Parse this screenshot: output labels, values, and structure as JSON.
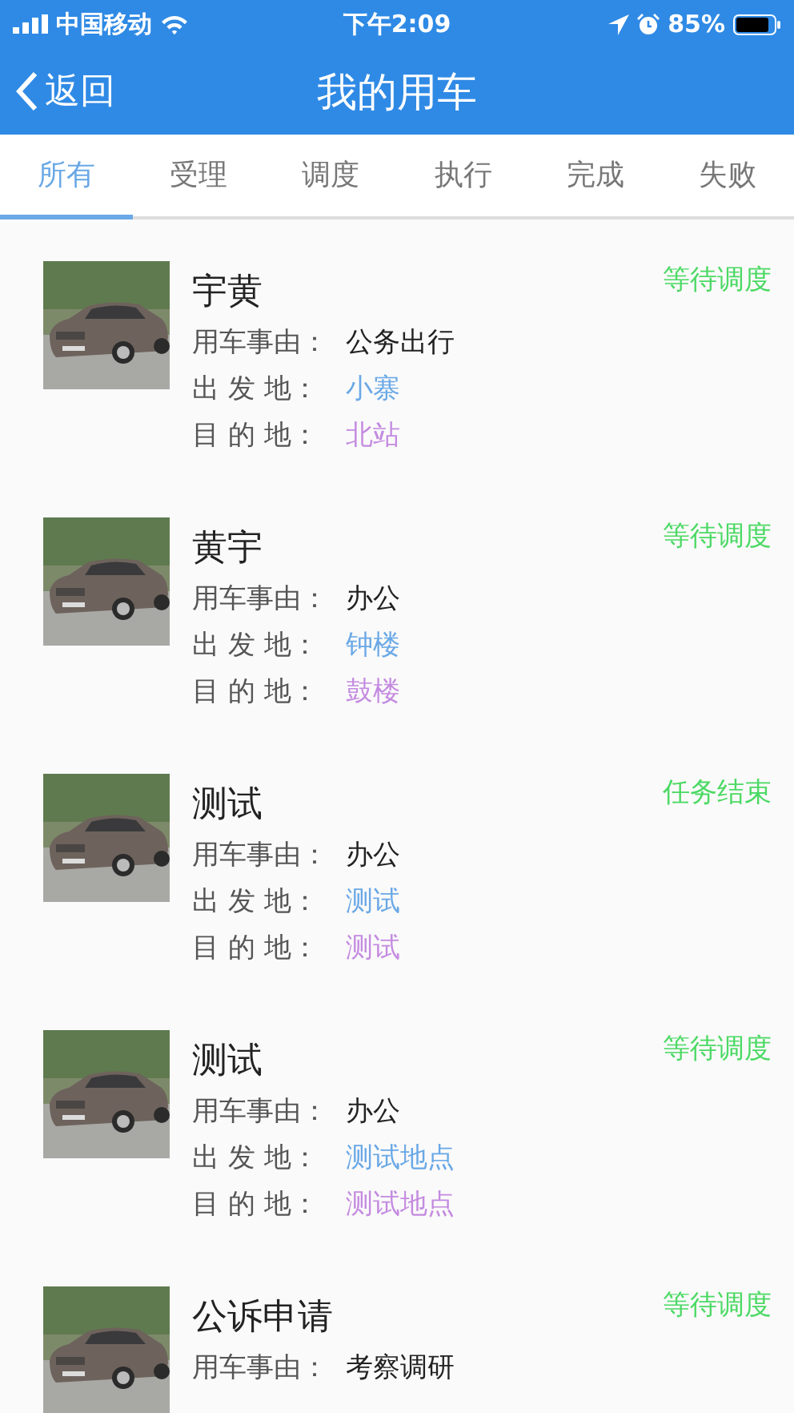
{
  "status_bar": {
    "carrier": "中国移动",
    "time": "下午2:09",
    "battery": "85%"
  },
  "nav": {
    "back": "返回",
    "title": "我的用车"
  },
  "tabs": [
    {
      "label": "所有",
      "selected": true
    },
    {
      "label": "受理",
      "selected": false
    },
    {
      "label": "调度",
      "selected": false
    },
    {
      "label": "执行",
      "selected": false
    },
    {
      "label": "完成",
      "selected": false
    },
    {
      "label": "失败",
      "selected": false
    }
  ],
  "requests": [
    {
      "title": "宇黄",
      "status": "等待调度",
      "fields": [
        {
          "kind": "reason",
          "label": "用车事由：",
          "value": "公务出行"
        },
        {
          "kind": "origin",
          "label": "出 发 地：",
          "value": "小寨"
        },
        {
          "kind": "destination",
          "label": "目 的 地：",
          "value": "北站"
        }
      ]
    },
    {
      "title": "黄宇",
      "status": "等待调度",
      "fields": [
        {
          "kind": "reason",
          "label": "用车事由：",
          "value": "办公"
        },
        {
          "kind": "origin",
          "label": "出 发 地：",
          "value": "钟楼"
        },
        {
          "kind": "destination",
          "label": "目 的 地：",
          "value": "鼓楼"
        }
      ]
    },
    {
      "title": "测试",
      "status": "任务结束",
      "fields": [
        {
          "kind": "reason",
          "label": "用车事由：",
          "value": "办公"
        },
        {
          "kind": "origin",
          "label": "出 发 地：",
          "value": "测试"
        },
        {
          "kind": "destination",
          "label": "目 的 地：",
          "value": "测试"
        }
      ]
    },
    {
      "title": "测试",
      "status": "等待调度",
      "fields": [
        {
          "kind": "reason",
          "label": "用车事由：",
          "value": "办公"
        },
        {
          "kind": "origin",
          "label": "出 发 地：",
          "value": "测试地点"
        },
        {
          "kind": "destination",
          "label": "目 的 地：",
          "value": "测试地点"
        }
      ]
    },
    {
      "title": "公诉申请",
      "status": "等待调度",
      "fields": [
        {
          "kind": "reason",
          "label": "用车事由：",
          "value": "考察调研"
        }
      ]
    }
  ]
}
